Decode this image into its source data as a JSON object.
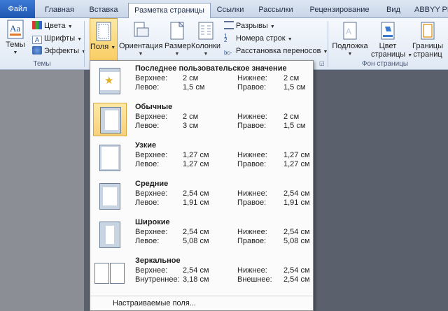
{
  "tabs": [
    "Файл",
    "Главная",
    "Вставка",
    "Разметка страницы",
    "Ссылки",
    "Рассылки",
    "Рецензирование",
    "Вид",
    "ABBYY PD"
  ],
  "ribbon": {
    "themes": {
      "big_label": "Темы",
      "colors": "Цвета",
      "fonts": "Шрифты",
      "effects": "Эффекты",
      "group": "Темы"
    },
    "margins": "Поля",
    "orientation": "Ориентация",
    "size": "Размер",
    "columns": "Колонки",
    "breaks": "Разрывы",
    "line_numbers": "Номера строк",
    "hyphenation": "Расстановка переносов",
    "watermark": "Подложка",
    "page_color": [
      "Цвет",
      "страницы"
    ],
    "page_borders": [
      "Границы",
      "страниц"
    ],
    "page_bg_group": "Фон страницы"
  },
  "menu": {
    "items": [
      {
        "name": "Последнее пользовательское значение",
        "top_label": "Верхнее:",
        "top": "2 см",
        "bottom_label": "Нижнее:",
        "bottom": "2 см",
        "left_label": "Левое:",
        "left": "1,5 см",
        "right_label": "Правое:",
        "right": "1,5 см"
      },
      {
        "name": "Обычные",
        "top_label": "Верхнее:",
        "top": "2 см",
        "bottom_label": "Нижнее:",
        "bottom": "2 см",
        "left_label": "Левое:",
        "left": "3 см",
        "right_label": "Правое:",
        "right": "1,5 см"
      },
      {
        "name": "Узкие",
        "top_label": "Верхнее:",
        "top": "1,27 см",
        "bottom_label": "Нижнее:",
        "bottom": "1,27 см",
        "left_label": "Левое:",
        "left": "1,27 см",
        "right_label": "Правое:",
        "right": "1,27 см"
      },
      {
        "name": "Средние",
        "top_label": "Верхнее:",
        "top": "2,54 см",
        "bottom_label": "Нижнее:",
        "bottom": "2,54 см",
        "left_label": "Левое:",
        "left": "1,91 см",
        "right_label": "Правое:",
        "right": "1,91 см"
      },
      {
        "name": "Широкие",
        "top_label": "Верхнее:",
        "top": "2,54 см",
        "bottom_label": "Нижнее:",
        "bottom": "2,54 см",
        "left_label": "Левое:",
        "left": "5,08 см",
        "right_label": "Правое:",
        "right": "5,08 см"
      },
      {
        "name": "Зеркальное",
        "top_label": "Верхнее:",
        "top": "2,54 см",
        "bottom_label": "Нижнее:",
        "bottom": "2,54 см",
        "left_label": "Внутреннее:",
        "left": "3,18 см",
        "right_label": "Внешнее:",
        "right": "2,54 см"
      }
    ],
    "custom": "Настраиваемые поля..."
  }
}
